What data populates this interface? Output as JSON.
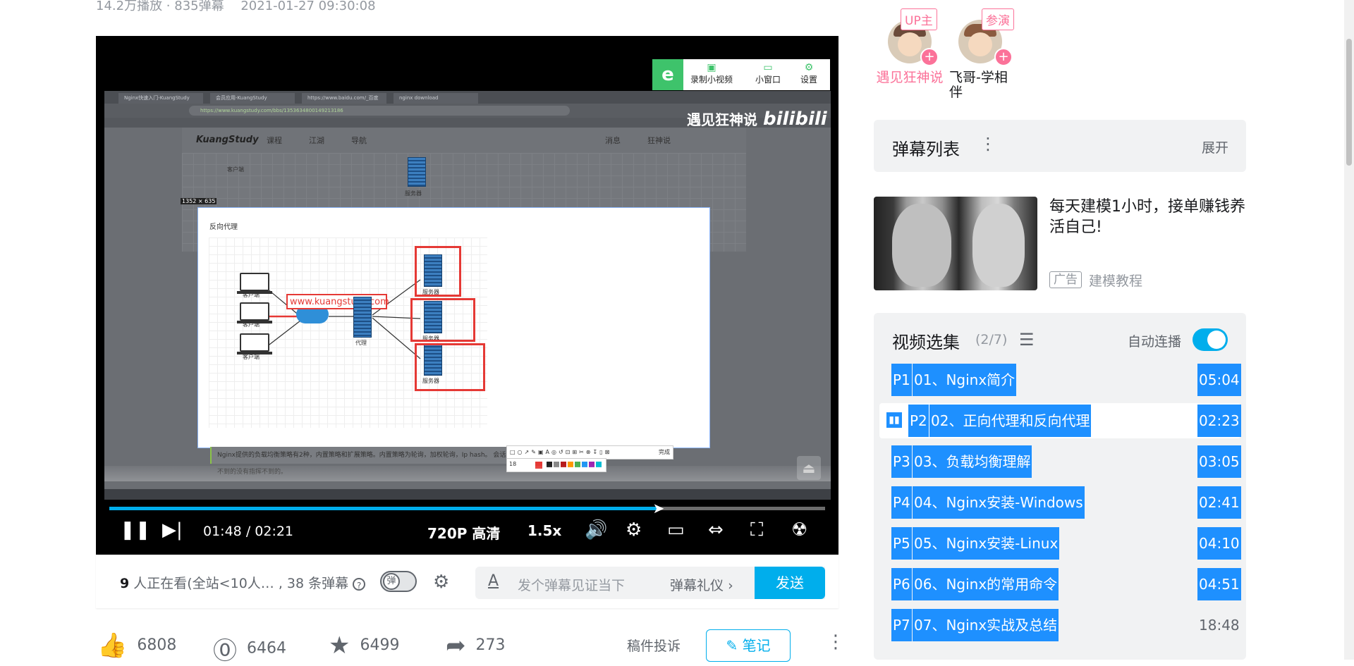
{
  "meta": {
    "plays": "14.2万播放 · 835弹幕",
    "date": "2021-01-27 09:30:08"
  },
  "video": {
    "browser_tabs": [
      "Nginx快速入门-KuangStudy",
      "会员应用-KuangStudy",
      "https://www.baidu.com/_百度",
      "nginx download"
    ],
    "address": "https://www.kuangstudy.com/bbs/1353634800149213186",
    "site_logo": "KuangStudy",
    "site_links": [
      "课程",
      "江湖",
      "导航"
    ],
    "site_right": [
      "消息",
      "狂神说"
    ],
    "popup_title": "反向代理",
    "size_badge": "1352 × 635",
    "url_label": "www.kuangstudy.com",
    "client_label": "客户端",
    "proxy_label": "代理",
    "server_label": "服务器",
    "text_strip": "Nginx提供的负载均衡策略有2种，内置策略和扩展策略。内置策略为轮询，加权轮询，Ip hash。",
    "text_strip_tail": "会话不到的没有指挥不到的。",
    "toolbar_done": "完成",
    "font_size": "18",
    "watermark_name": "遇见狂神说",
    "watermark_logo": "bilibili",
    "tool_logo": "e",
    "tool_buttons": [
      {
        "label": "录制小视频",
        "icon": "record-icon"
      },
      {
        "label": "小窗口",
        "icon": "mini-window-icon"
      },
      {
        "label": "设置",
        "icon": "settings-icon"
      }
    ],
    "progress": 0.767,
    "time_current": "01:48",
    "time_sep": "/",
    "time_total": "02:21",
    "quality": "720P 高清",
    "speed": "1.5x",
    "accent_color": "#00aeec"
  },
  "sendbar": {
    "watching_count": "9",
    "watching_text": " 人正在看(全站<10人… , 38 条弹幕",
    "help": "?",
    "danmaku_switch": "弹",
    "input_icon": "A",
    "placeholder": "发个弹幕见证当下",
    "etiquette": "弹幕礼仪",
    "send": "发送"
  },
  "actions": {
    "like": "6808",
    "coin": "6464",
    "favorite": "6499",
    "share": "273",
    "report": "稿件投诉",
    "notes": "笔记"
  },
  "creators": [
    {
      "role": "UP主",
      "name": "遇见狂神说",
      "name_color": "#fb7299"
    },
    {
      "role": "参演",
      "name": "飞哥-学相伴",
      "name_color": "#18191c"
    }
  ],
  "danmaku_panel": {
    "title": "弹幕列表",
    "expand": "展开"
  },
  "ad": {
    "title": "每天建模1小时，接单赚钱养活自己!",
    "tag": "广告",
    "source": "建模教程"
  },
  "playlist": {
    "title": "视频选集",
    "count": "(2/7)",
    "autoplay": "自动连播",
    "autoplay_on": true,
    "items": [
      {
        "p": "P1",
        "title": "01、Nginx简介",
        "dur": "05:04"
      },
      {
        "p": "P2",
        "title": "02、正向代理和反向代理",
        "dur": "02:23"
      },
      {
        "p": "P3",
        "title": "03、负载均衡理解",
        "dur": "03:05"
      },
      {
        "p": "P4",
        "title": "04、Nginx安装-Windows",
        "dur": "02:41"
      },
      {
        "p": "P5",
        "title": "05、Nginx安装-Linux",
        "dur": "04:10"
      },
      {
        "p": "P6",
        "title": "06、Nginx的常用命令",
        "dur": "04:51"
      },
      {
        "p": "P7",
        "title": "07、Nginx实战及总结",
        "dur": "18:48"
      }
    ]
  }
}
